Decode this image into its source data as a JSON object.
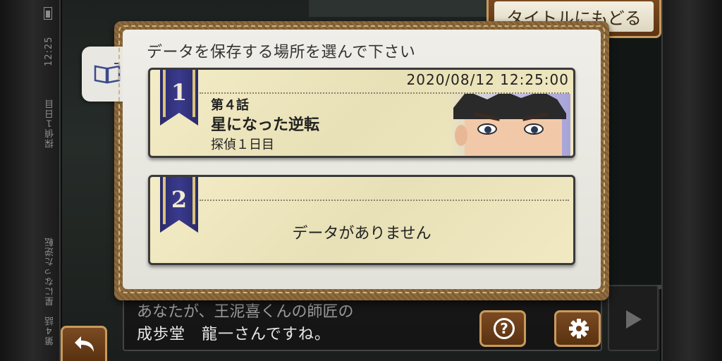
{
  "status_bar": {
    "time": "12:25",
    "chapter_progress": "探偵１日目",
    "chapter_name": "第４話　星になった逆転"
  },
  "top_button": {
    "label": "タイトルにもどる"
  },
  "panel": {
    "heading": "データを保存する場所を選んで下さい",
    "tab_icon": "book-icon"
  },
  "slots": [
    {
      "number": "1",
      "date": "2020/08/12 12:25:00",
      "episode": "第４話",
      "title": "星になった逆転",
      "subtitle": "探偵１日目"
    },
    {
      "number": "2",
      "empty_text": "データがありません"
    }
  ],
  "dialog": {
    "line1": "あなたが、王泥喜くんの師匠の",
    "line2": "成歩堂　龍一さんですね。"
  },
  "buttons": {
    "help_icon": "question-icon",
    "settings_icon": "gear-icon",
    "back_icon": "back-arrow-icon",
    "next_icon": "play-arrow-icon"
  },
  "colors": {
    "accent_brown": "#7a4a22",
    "gold_trim": "#c89a5c",
    "ribbon_navy": "#2a2a6a",
    "slot_cream": "#f3ecc6"
  }
}
